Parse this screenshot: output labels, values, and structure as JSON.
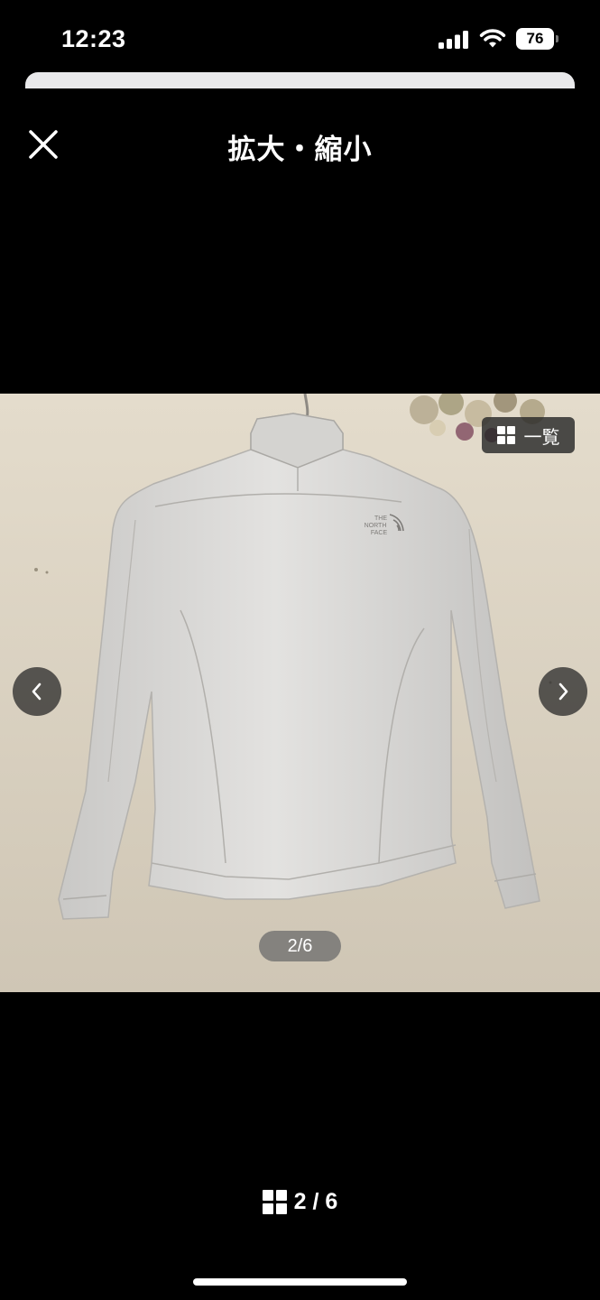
{
  "status_bar": {
    "time": "12:23",
    "battery": "76",
    "icons": [
      "signal-icon",
      "wifi-icon",
      "battery-icon"
    ]
  },
  "header": {
    "title": "拡大・縮小",
    "close_icon": "close-icon"
  },
  "viewer": {
    "grid_button_label": "一覧",
    "grid_icon": "grid-icon",
    "prev_icon": "chevron-left-icon",
    "next_icon": "chevron-right-icon",
    "photo_counter": "2/6",
    "photo_logo_text": [
      "THE",
      "NORTH",
      "FACE"
    ]
  },
  "footer": {
    "counter": "2 / 6",
    "grid_icon": "grid-icon"
  }
}
